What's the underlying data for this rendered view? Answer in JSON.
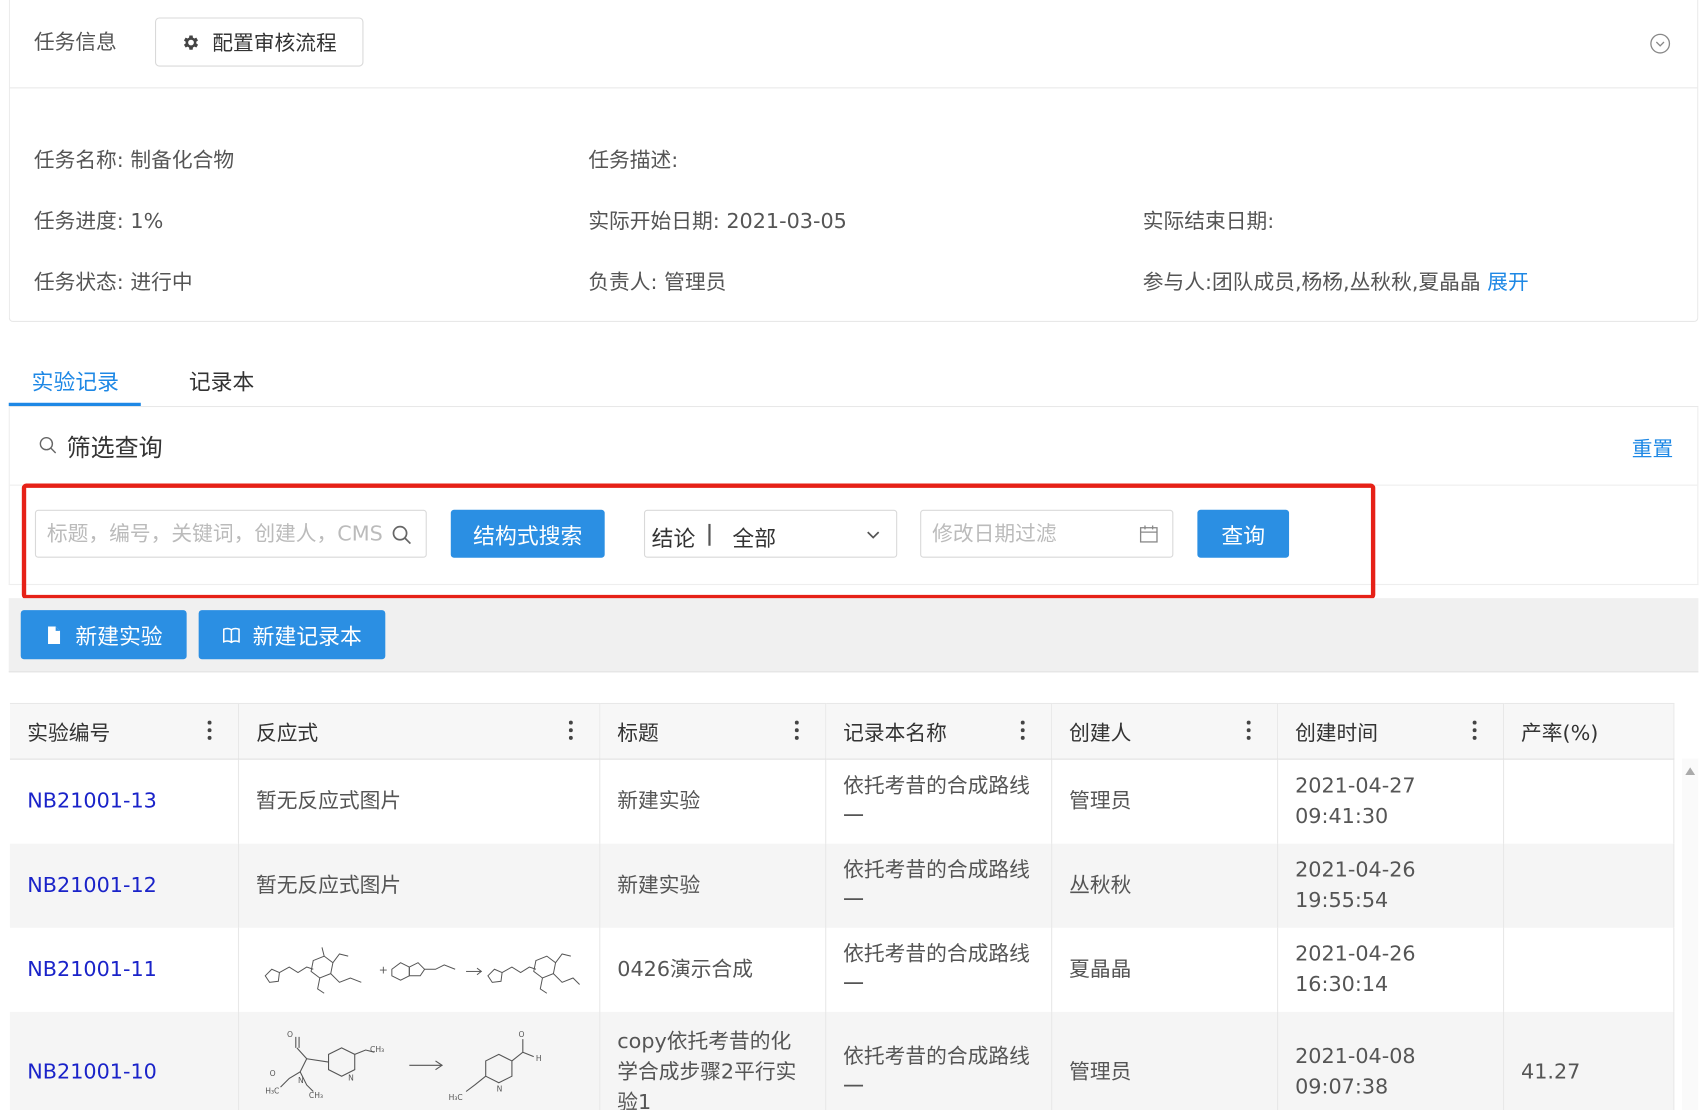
{
  "task_info": {
    "title": "任务信息",
    "config_button": "配置审核流程",
    "name_label": "任务名称:",
    "name_value": "制备化合物",
    "desc_label": "任务描述:",
    "progress": "任务进度: 1%",
    "actual_start": "实际开始日期: 2021-03-05",
    "actual_end": "实际结束日期:",
    "status": "任务状态: 进行中",
    "owner": "负责人: 管理员",
    "participants": "参与人:团队成员,杨杨,丛秋秋,夏晶晶",
    "expand_link": "展开"
  },
  "tabs": [
    {
      "label": "实验记录",
      "active": true
    },
    {
      "label": "记录本",
      "active": false
    }
  ],
  "filter": {
    "title": "筛选查询",
    "reset": "重置",
    "keyword_placeholder": "标题，编号，关键词，创建人，CMS",
    "structure_search": "结构式搜索",
    "conclusion_label": "结论",
    "conclusion_value": "全部",
    "date_placeholder": "修改日期过滤",
    "query_button": "查询"
  },
  "actions": {
    "new_experiment": "新建实验",
    "new_notebook": "新建记录本"
  },
  "table": {
    "columns": [
      "实验编号",
      "反应式",
      "标题",
      "记录本名称",
      "创建人",
      "创建时间",
      "产率(%)"
    ],
    "rows": [
      {
        "id": "NB21001-13",
        "reaction": "暂无反应式图片",
        "title": "新建实验",
        "notebook": "依托考昔的合成路线一",
        "creator": "管理员",
        "created": "2021-04-27 09:41:30",
        "yield": ""
      },
      {
        "id": "NB21001-12",
        "reaction": "暂无反应式图片",
        "title": "新建实验",
        "notebook": "依托考昔的合成路线一",
        "creator": "丛秋秋",
        "created": "2021-04-26 19:55:54",
        "yield": ""
      },
      {
        "id": "NB21001-11",
        "reaction": "",
        "title": "0426演示合成",
        "notebook": "依托考昔的合成路线一",
        "creator": "夏晶晶",
        "created": "2021-04-26 16:30:14",
        "yield": ""
      },
      {
        "id": "NB21001-10",
        "reaction": "",
        "title": "copy依托考昔的化学合成步骤2平行实验1",
        "notebook": "依托考昔的合成路线一",
        "creator": "管理员",
        "created": "2021-04-08 09:07:38",
        "yield": "41.27"
      }
    ]
  },
  "colors": {
    "accent": "#2b8fe3",
    "link": "#1e88e5",
    "id_link": "#1a23c9",
    "highlight_frame": "#e62117"
  },
  "icons": [
    "gear-icon",
    "chevron-circle-icon",
    "search-icon",
    "chevron-down-icon",
    "calendar-icon",
    "file-icon",
    "book-icon",
    "column-menu-icon",
    "scroll-up-icon"
  ]
}
